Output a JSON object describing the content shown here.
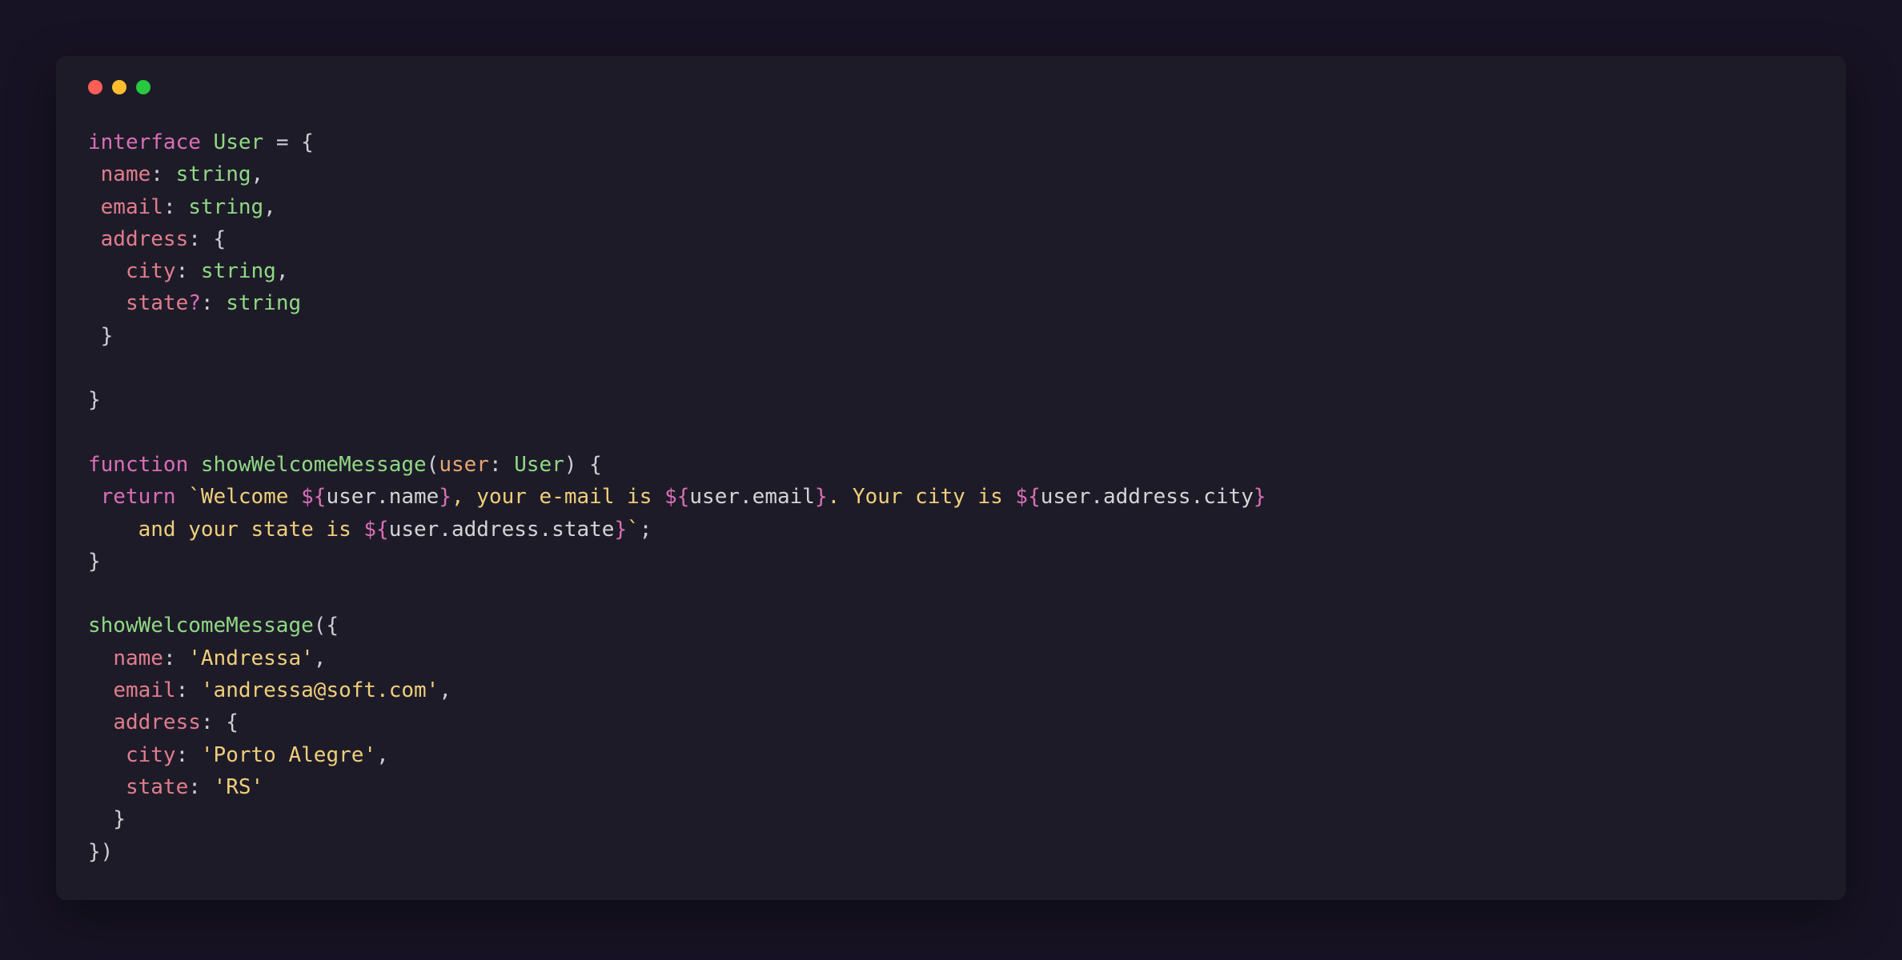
{
  "colors": {
    "background": "#171324",
    "windowBg": "#1e1b29",
    "dotRed": "#ff5f56",
    "dotYellow": "#ffbd2e",
    "dotGreen": "#27c93f",
    "keyword": "#d96fb6",
    "type": "#8fd983",
    "property": "#e27d8b",
    "param": "#e6a76f",
    "string": "#efcf79",
    "punct": "#cfcfd1"
  },
  "code": {
    "l1": {
      "kw": "interface",
      "type": "User",
      "eq": " = {"
    },
    "l2": {
      "prop": "name",
      "type": "string",
      "after": ","
    },
    "l3": {
      "prop": "email",
      "type": "string",
      "after": ","
    },
    "l4": {
      "prop": "address",
      "brace": ": {"
    },
    "l5": {
      "prop": "city",
      "type": "string",
      "after": ","
    },
    "l6": {
      "prop": "state",
      "q": "?",
      "type": "string"
    },
    "l7": {
      "brace": " }"
    },
    "l8": {
      "empty": ""
    },
    "l9": {
      "brace": "}"
    },
    "l10": {
      "empty": ""
    },
    "l11": {
      "kw": "function",
      "fn": "showWelcomeMessage",
      "open": "(",
      "param": "user",
      "colon": ": ",
      "type": "User",
      "close": ") {"
    },
    "l12": {
      "kw": "return",
      "bt": "`",
      "t1": "Welcome ",
      "d1": "${",
      "v1": "user.name",
      "d2": "}",
      "t2": ", your e-mail is ",
      "d3": "${",
      "v2": "user.email",
      "d4": "}",
      "t3": ". Your city is ",
      "d5": "${",
      "v3": "user.address.city",
      "d6": "}"
    },
    "l13": {
      "t1": "    and your state is ",
      "d1": "${",
      "v1": "user.address.state",
      "d2": "}",
      "bt": "`",
      "semi": ";"
    },
    "l14": {
      "brace": "}"
    },
    "l15": {
      "empty": ""
    },
    "l16": {
      "fn": "showWelcomeMessage",
      "open": "({"
    },
    "l17": {
      "prop": "name",
      "colon": ": ",
      "str": "'Andressa'",
      "after": ","
    },
    "l18": {
      "prop": "email",
      "colon": ": ",
      "str": "'andressa@soft.com'",
      "after": ","
    },
    "l19": {
      "prop": "address",
      "brace": ": {"
    },
    "l20": {
      "prop": "city",
      "colon": ": ",
      "str": "'Porto Alegre'",
      "after": ","
    },
    "l21": {
      "prop": "state",
      "colon": ": ",
      "str": "'RS'"
    },
    "l22": {
      "brace": "  }"
    },
    "l23": {
      "brace": "})"
    }
  }
}
